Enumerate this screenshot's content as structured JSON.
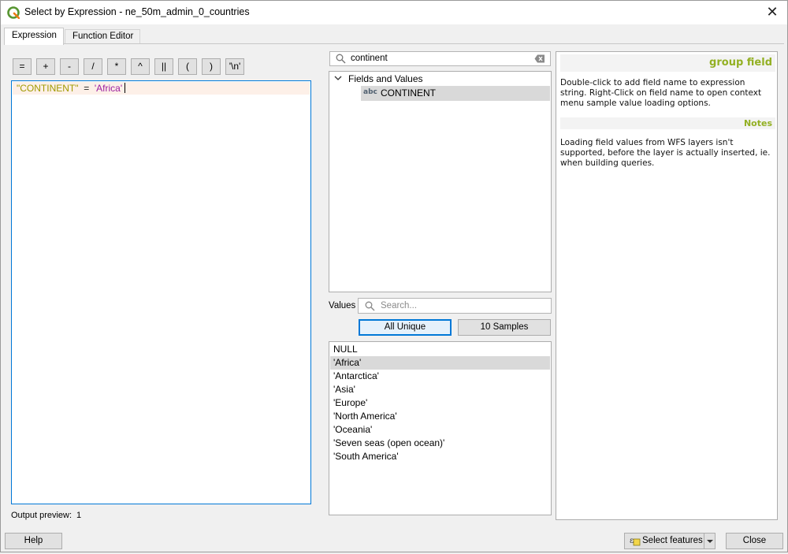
{
  "window": {
    "title": "Select by Expression - ne_50m_admin_0_countries"
  },
  "tabs": [
    {
      "label": "Expression",
      "active": true
    },
    {
      "label": "Function Editor",
      "active": false
    }
  ],
  "operators": [
    "=",
    "+",
    "-",
    "/",
    "*",
    "^",
    "||",
    "(",
    ")",
    "'\\n'"
  ],
  "expression": {
    "field": "\"CONTINENT\"",
    "operator": "=",
    "value": "'Africa'"
  },
  "output_preview": {
    "label": "Output preview:",
    "value": "1"
  },
  "function_search": {
    "value": "continent"
  },
  "tree": {
    "group_label": "Fields and Values",
    "item_type": "abc",
    "item_label": "CONTINENT"
  },
  "values_panel": {
    "label": "Values",
    "search_placeholder": "Search...",
    "all_unique_label": "All Unique",
    "samples_label": "10 Samples",
    "items": [
      "NULL",
      "'Africa'",
      "'Antarctica'",
      "'Asia'",
      "'Europe'",
      "'North America'",
      "'Oceania'",
      "'Seven seas (open ocean)'",
      "'South America'"
    ],
    "selected_index": 1
  },
  "help": {
    "heading": "group field",
    "description": "Double-click to add field name to expression string. Right-Click on field name to open context menu sample value loading options.",
    "notes_heading": "Notes",
    "notes": "Loading field values from WFS layers isn't supported, before the layer is actually inserted, ie. when building queries."
  },
  "buttons": {
    "help_label": "Help",
    "select_label": "Select features",
    "close_label": "Close"
  },
  "colors": {
    "accent": "#0078d7",
    "help_heading": "#93b023",
    "field_token": "#a09a00",
    "string_token": "#9c1fa0"
  }
}
